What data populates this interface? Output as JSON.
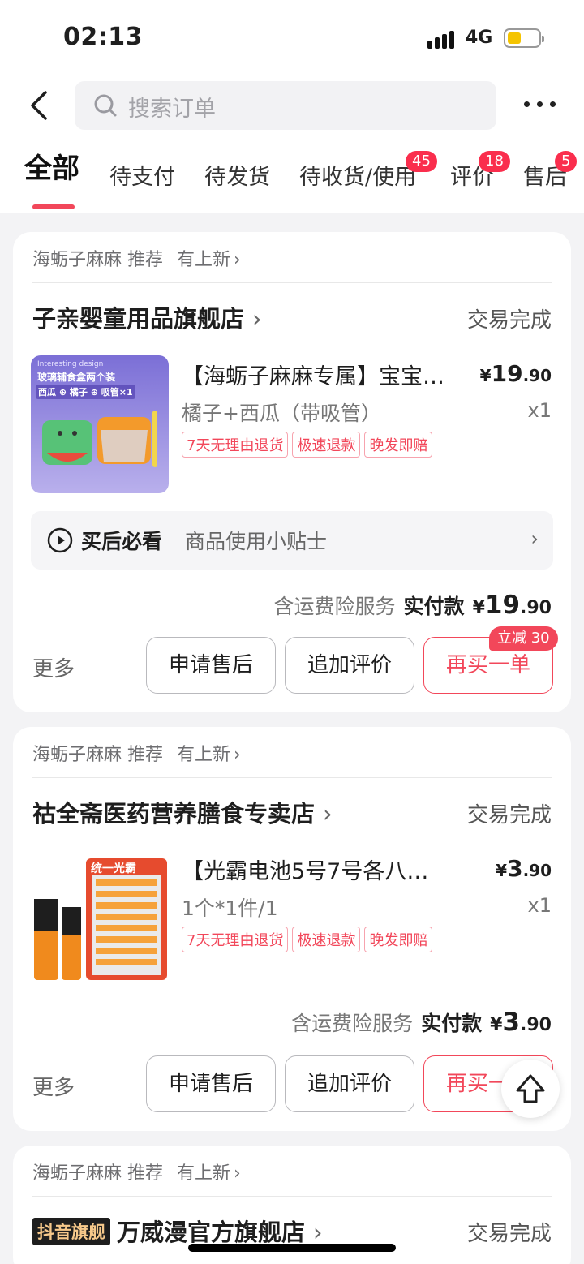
{
  "status_bar": {
    "time": "02:13",
    "network": "4G"
  },
  "header": {
    "search_placeholder": "搜索订单"
  },
  "tabs": [
    {
      "label": "全部",
      "active": true
    },
    {
      "label": "待支付"
    },
    {
      "label": "待发货"
    },
    {
      "label": "待收货/使用",
      "badge": "45"
    },
    {
      "label": "评价",
      "badge": "18"
    },
    {
      "label": "售后",
      "badge": "5"
    }
  ],
  "orders": [
    {
      "recommend": "海蛎子麻麻 推荐",
      "new_label": "有上新",
      "shop": "子亲婴童用品旗舰店",
      "status": "交易完成",
      "thumb_caption_1": "Interesting design",
      "thumb_caption_2": "玻璃辅食盒两个装",
      "thumb_caption_3": "西瓜 ⊕ 橘子 ⊕ 吸管×1",
      "title": "【海蛎子麻麻专属】宝宝…",
      "price_symbol": "¥",
      "price_int": "19",
      "price_dec": ".90",
      "spec": "橘子+西瓜（带吸管）",
      "qty": "x1",
      "tags": [
        "7天无理由退货",
        "极速退款",
        "晚发即赔"
      ],
      "tips_title": "买后必看",
      "tips_text": "商品使用小贴士",
      "service": "含运费险服务",
      "paid_label": "实付款",
      "paid_symbol": "¥",
      "paid_int": "19",
      "paid_dec": ".90",
      "more": "更多",
      "btn_after_sale": "申请售后",
      "btn_review": "追加评价",
      "btn_rebuy": "再买一单",
      "promo": "立减 30"
    },
    {
      "recommend": "海蛎子麻麻 推荐",
      "new_label": "有上新",
      "shop": "祜全斋医药营养膳食专卖店",
      "status": "交易完成",
      "thumb_caption_1": "统一光霸",
      "title": "【光霸电池5号7号各八节…",
      "price_symbol": "¥",
      "price_int": "3",
      "price_dec": ".90",
      "spec": "1个*1件/1",
      "qty": "x1",
      "tags": [
        "7天无理由退货",
        "极速退款",
        "晚发即赔"
      ],
      "service": "含运费险服务",
      "paid_label": "实付款",
      "paid_symbol": "¥",
      "paid_int": "3",
      "paid_dec": ".90",
      "more": "更多",
      "btn_after_sale": "申请售后",
      "btn_review": "追加评价",
      "btn_rebuy": "再买一单"
    },
    {
      "recommend": "海蛎子麻麻 推荐",
      "new_label": "有上新",
      "brand_badge": "抖音旗舰",
      "shop": "万威漫官方旗舰店",
      "status": "交易完成"
    }
  ]
}
